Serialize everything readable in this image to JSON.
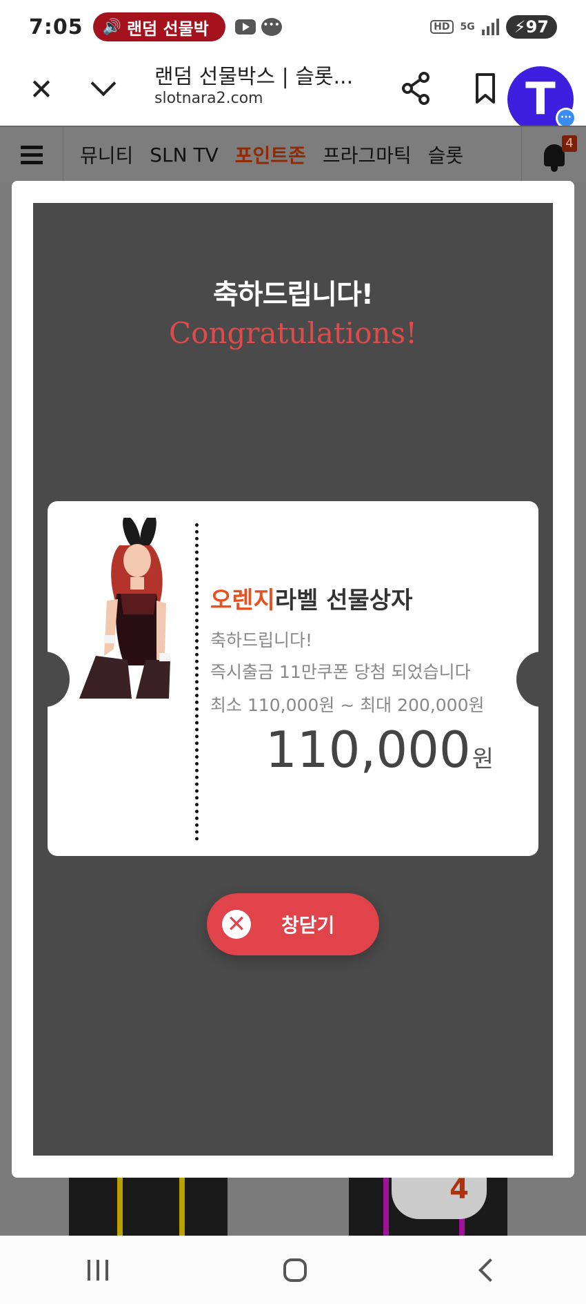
{
  "status_bar": {
    "time": "7:05",
    "media_title": "랜덤 선물박",
    "battery": "97",
    "network": "5G",
    "hd": "HD"
  },
  "browser": {
    "page_title": "랜덤 선물박스 | 슬롯...",
    "url": "slotnara2.com",
    "notification_bubble": "···"
  },
  "site_nav": {
    "items": [
      "뮤니티",
      "SLN TV",
      "포인트존",
      "프라그마틱",
      "슬롯"
    ],
    "active_index": 2,
    "bell_count": "4"
  },
  "background": {
    "badge_count": "4"
  },
  "popup": {
    "heading_ko": "축하드립니다!",
    "heading_en": "Congratulations!",
    "ticket": {
      "title_accent": "오렌지",
      "title_rest": "라벨 선물상자",
      "line1": "축하드립니다!",
      "line2": "즉시출금 11만쿠폰 당첨 되었습니다",
      "line3": "최소 110,000원 ~ 최대 200,000원",
      "amount": "110,000",
      "amount_unit": "원"
    },
    "close_button": "창닫기"
  },
  "colors": {
    "accent_orange": "#e8501e",
    "close_red": "#e0434a",
    "congrats_red": "#e04a4a",
    "popup_bg": "#4a4a4a",
    "tmap_blue": "#3e1fe0"
  }
}
